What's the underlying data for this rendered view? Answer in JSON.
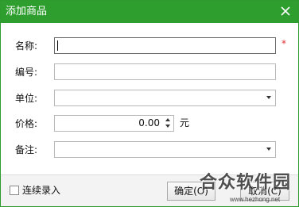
{
  "window": {
    "title": "添加商品"
  },
  "form": {
    "name_label": "名称:",
    "required_mark": "*",
    "code_label": "编号:",
    "unit_label": "单位:",
    "price_label": "价格:",
    "price_value": "0.00",
    "price_unit": "元",
    "note_label": "备注:"
  },
  "footer": {
    "continuous_label": "连续录入",
    "ok_label": "确定(O)",
    "cancel_label": "取消(C)"
  },
  "watermark": {
    "text": "合众软件园",
    "url": "www.hezhong.net"
  },
  "colors": {
    "titlebar": "#2e9e2e",
    "required": "#e03030"
  },
  "icons": [
    "close-icon",
    "dropdown-arrow-icon",
    "spin-up-icon",
    "spin-down-icon",
    "checkbox-icon"
  ]
}
